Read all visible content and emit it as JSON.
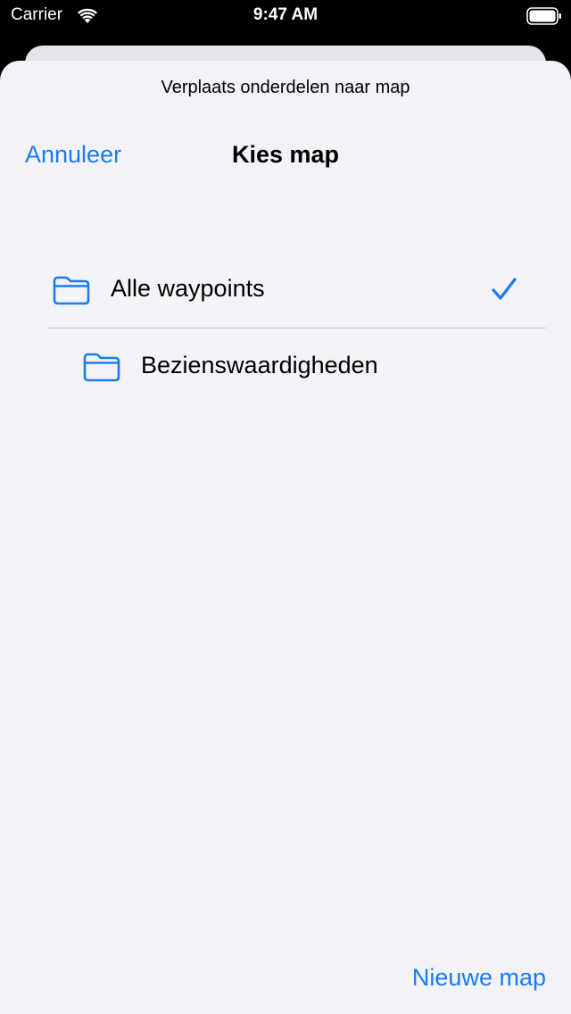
{
  "status_bar": {
    "carrier": "Carrier",
    "time": "9:47 AM",
    "icons": [
      "wifi-icon",
      "battery-icon"
    ]
  },
  "sheet": {
    "prompt": "Verplaats onderdelen naar map",
    "nav": {
      "cancel_label": "Annuleer",
      "title": "Kies map"
    },
    "folders": [
      {
        "label": "Alle waypoints",
        "icon": "folder-icon",
        "selected": true,
        "indent_level": 0
      },
      {
        "label": "Bezienswaardigheden",
        "icon": "folder-icon",
        "selected": false,
        "indent_level": 1
      }
    ],
    "new_folder_label": "Nieuwe map"
  },
  "colors": {
    "accent": "#1a7cf2",
    "sheet_background": "#f2f2f7",
    "status_bar_background": "#000000"
  }
}
